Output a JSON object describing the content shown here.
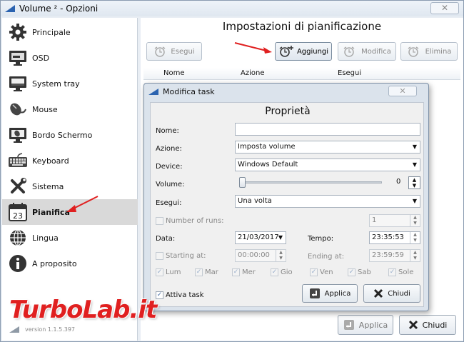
{
  "window": {
    "title": "Volume ² - Opzioni",
    "close_glyph": "✕"
  },
  "sidebar": {
    "items": [
      {
        "label": "Principale",
        "icon": "gear-icon"
      },
      {
        "label": "OSD",
        "icon": "monitor-icon"
      },
      {
        "label": "System tray",
        "icon": "tray-icon"
      },
      {
        "label": "Mouse",
        "icon": "mouse-icon"
      },
      {
        "label": "Bordo Schermo",
        "icon": "screen-edge-icon"
      },
      {
        "label": "Keyboard",
        "icon": "keyboard-icon"
      },
      {
        "label": "Sistema",
        "icon": "tools-icon"
      },
      {
        "label": "Pianifica",
        "icon": "calendar-icon",
        "calendar_day": "23",
        "selected": true
      },
      {
        "label": "Lingua",
        "icon": "globe-icon"
      },
      {
        "label": "A proposito",
        "icon": "info-icon"
      }
    ],
    "version": "version 1.1.5.397"
  },
  "main": {
    "title": "Impostazioni di pianificazione",
    "toolbar": {
      "run": "Esegui",
      "add": "Aggiungi",
      "edit": "Modifica",
      "delete": "Elimina"
    },
    "columns": [
      "Nome",
      "Azione",
      "Esegui"
    ],
    "apply": "Applica",
    "close": "Chiudi"
  },
  "dialog": {
    "title": "Modifica task",
    "close_glyph": "✕",
    "heading": "Proprietà",
    "name_label": "Nome:",
    "name_value": "",
    "action_label": "Azione:",
    "action_value": "Imposta volume",
    "device_label": "Device:",
    "device_value": "Windows Default",
    "volume_label": "Volume:",
    "volume_value": "0",
    "run_label": "Esegui:",
    "run_value": "Una volta",
    "runs_label": "Number of runs:",
    "runs_value": "1",
    "date_label": "Data:",
    "date_value": "21/03/2017",
    "time_label": "Tempo:",
    "time_value": "23:35:53",
    "starting_label": "Starting at:",
    "starting_value": "00:00:00",
    "ending_label": "Ending at:",
    "ending_value": "23:59:59",
    "days": [
      "Lum",
      "Mar",
      "Mer",
      "Gio",
      "Ven",
      "Sab",
      "Sole"
    ],
    "active_label": "Attiva task",
    "apply": "Applica",
    "close": "Chiudi"
  },
  "watermark": "TurboLab.it",
  "colors": {
    "accent_arrow": "#e02020",
    "selected_bg": "#d9d9d9"
  }
}
